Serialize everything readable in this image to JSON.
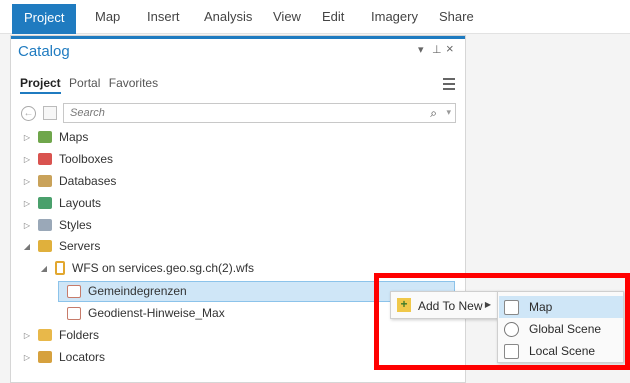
{
  "ribbon": {
    "tabs": [
      "Project",
      "Map",
      "Insert",
      "Analysis",
      "View",
      "Edit",
      "Imagery",
      "Share"
    ]
  },
  "catalog": {
    "title": "Catalog",
    "controls": {
      "menu": "▾",
      "pin": "⊥",
      "close": "×"
    },
    "subtabs": [
      "Project",
      "Portal",
      "Favorites"
    ],
    "search_placeholder": "Search",
    "tree": {
      "maps": "Maps",
      "toolboxes": "Toolboxes",
      "databases": "Databases",
      "layouts": "Layouts",
      "styles": "Styles",
      "servers": "Servers",
      "wfs": "WFS on services.geo.sg.ch(2).wfs",
      "gemeinde": "Gemeindegrenzen",
      "geodienst": "Geodienst-Hinweise_Max",
      "folders": "Folders",
      "locators": "Locators"
    }
  },
  "context_menu": {
    "add_to_new": "Add To New"
  },
  "submenu": {
    "map": "Map",
    "global_scene": "Global Scene",
    "local_scene": "Local Scene"
  },
  "colors": {
    "accent": "#1f7bc0",
    "highlight": "#cfe6f7",
    "annotation": "#ff0000"
  }
}
